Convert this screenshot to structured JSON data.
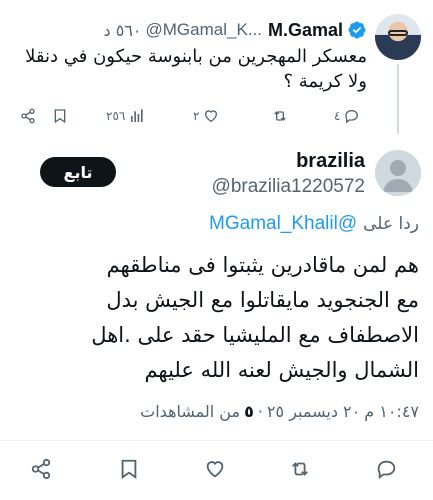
{
  "parent_tweet": {
    "name": "M.Gamal",
    "handle": "@MGamal_K...",
    "time_ago": "٥٦٠ د",
    "text_lines": [
      "معسكر المهجرين من بابنوسة حيكون في دنقلا",
      "ولا كريمة ؟"
    ],
    "actions": {
      "replies": "٤",
      "likes": "٢",
      "views": "٢٥٦"
    }
  },
  "main_tweet": {
    "name": "brazilia",
    "handle": "@brazilia1220572",
    "follow_label": "تابع",
    "reply_prefix": "ردا على",
    "reply_mention": "@MGamal_Khalil",
    "text_lines": [
      "هم لمن ماقادرين يثبتوا فى مناطقهم",
      "مع الجنجويد مايقاتلوا مع الجيش بدل",
      "الاصطفاف مع المليشيا  حقد على .اهل",
      "الشمال والجيش لعنه الله عليهم"
    ],
    "meta": {
      "time": "١٠:٤٧ م",
      "date": "٢٠ ديسمبر ٢٥",
      "dot": "·",
      "views_count": "٥",
      "views_label": "من المشاهدات"
    }
  },
  "colors": {
    "text": "#0f1419",
    "secondary": "#536471",
    "link": "#1d9bf0",
    "verified": "#1d9bf0",
    "divider": "#eff3f4"
  },
  "icons": [
    "verified-icon",
    "share-icon",
    "bookmark-icon",
    "views-icon",
    "like-icon",
    "retweet-icon",
    "reply-icon",
    "avatar-placeholder"
  ]
}
